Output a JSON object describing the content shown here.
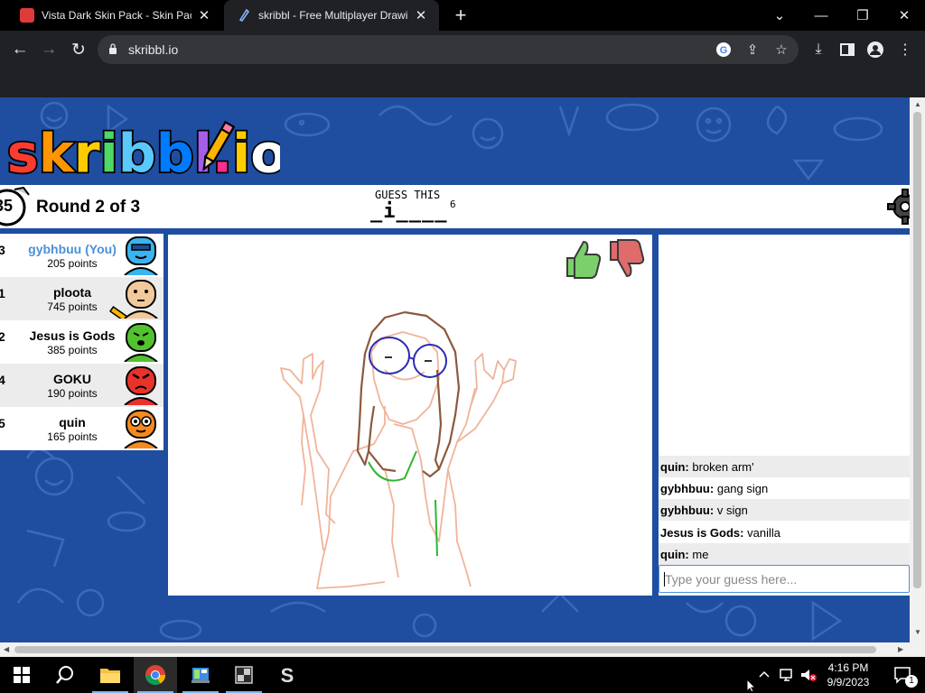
{
  "browser": {
    "tabs": [
      {
        "title": "Vista Dark Skin Pack - Skin Pack f",
        "active": false
      },
      {
        "title": "skribbl - Free Multiplayer Drawing",
        "active": true
      }
    ],
    "url": "skribbl.io",
    "icons": {
      "back": "←",
      "forward": "→",
      "reload": "↻",
      "new_tab": "+",
      "minimize": "—",
      "maximize": "❐",
      "close": "✕",
      "tab_list": "⌄",
      "share": "⇪",
      "star": "☆",
      "download": "⤓",
      "menu": "⋮"
    }
  },
  "game": {
    "logo_text": "skribbl.io",
    "timer": "35",
    "round_text": "Round 2 of 3",
    "guess_label": "GUESS THIS",
    "hint": "_i____",
    "word_length": "6",
    "players": [
      {
        "rank": "3",
        "name": "gybhbuu (You)",
        "points": "205 points",
        "self": true,
        "avatar_color": "#3bb3f0"
      },
      {
        "rank": "1",
        "name": "ploota",
        "points": "745 points",
        "self": false,
        "avatar_color": "#f2c99a",
        "drawing": true
      },
      {
        "rank": "2",
        "name": "Jesus is Gods",
        "points": "385 points",
        "self": false,
        "avatar_color": "#52c22e"
      },
      {
        "rank": "4",
        "name": "GOKU",
        "points": "190 points",
        "self": false,
        "avatar_color": "#e8332a"
      },
      {
        "rank": "5",
        "name": "quin",
        "points": "165 points",
        "self": false,
        "avatar_color": "#f58a1f"
      }
    ],
    "chat": [
      {
        "user": "quin:",
        "text": "broken arm'"
      },
      {
        "user": "gybhbuu:",
        "text": "gang sign"
      },
      {
        "user": "gybhbuu:",
        "text": "v sign"
      },
      {
        "user": "Jesus is Gods:",
        "text": "vanilla"
      },
      {
        "user": "quin:",
        "text": "me"
      }
    ],
    "chat_placeholder": "Type your guess here...",
    "colors": {
      "background": "#1f4ea1",
      "self_name": "#4a90d9",
      "like": "#7bd06b",
      "dislike": "#e06b6b"
    }
  },
  "taskbar": {
    "time": "4:16 PM",
    "date": "9/9/2023",
    "notification_count": "1",
    "apps": [
      "start-icon",
      "search-icon",
      "file-explorer-icon",
      "chrome-icon",
      "control-panel-icon",
      "app-icon",
      "skinpack-icon"
    ]
  }
}
